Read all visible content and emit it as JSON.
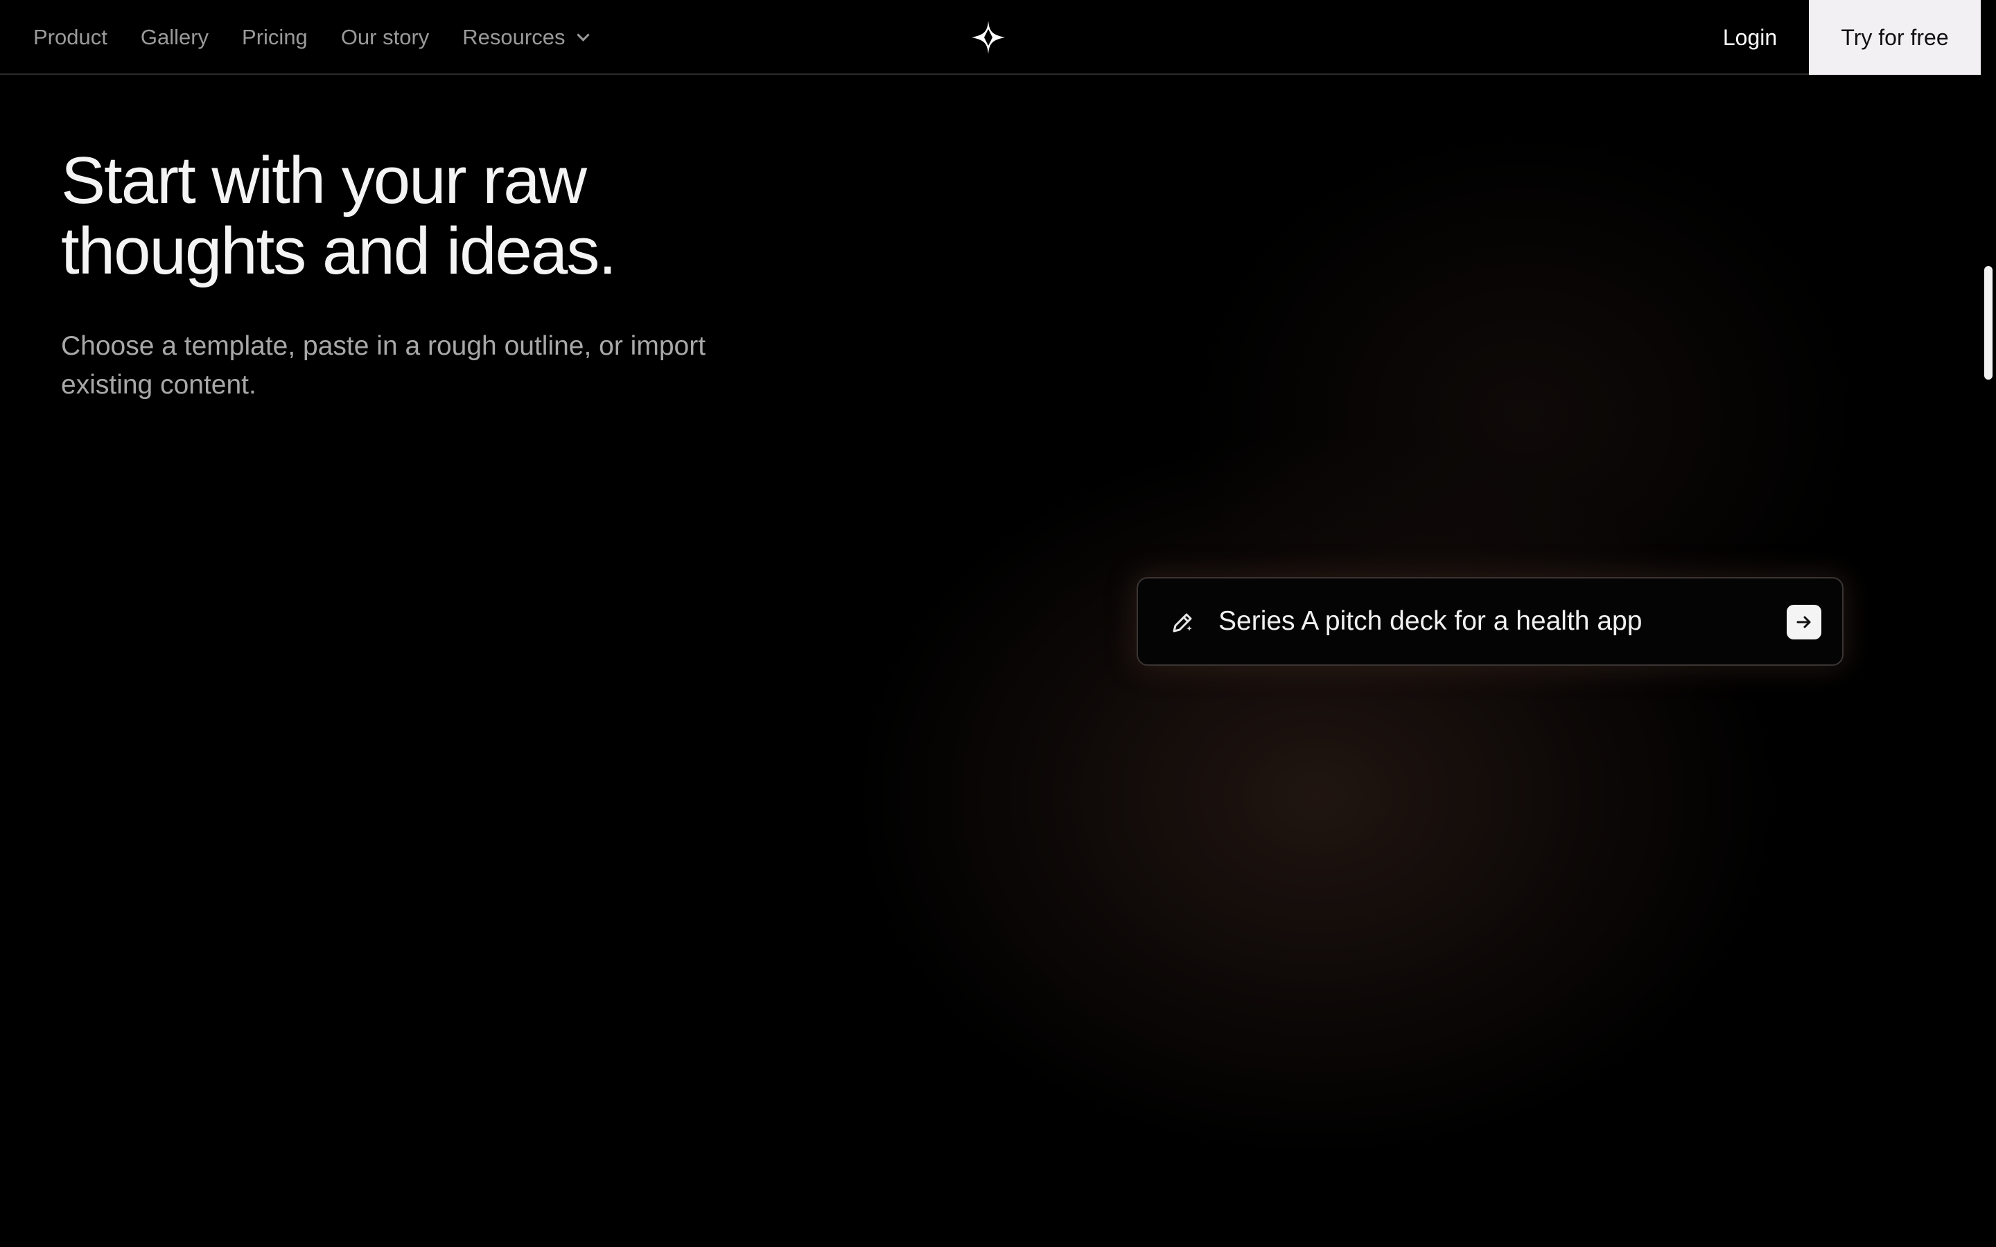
{
  "nav": {
    "items": [
      {
        "label": "Product"
      },
      {
        "label": "Gallery"
      },
      {
        "label": "Pricing"
      },
      {
        "label": "Our story"
      },
      {
        "label": "Resources"
      }
    ],
    "login_label": "Login",
    "cta_label": "Try for free"
  },
  "hero": {
    "headline_line1": "Start with your raw",
    "headline_line2": "thoughts and ideas.",
    "subhead_line1": "Choose a template, paste in a rough outline, or import",
    "subhead_line2": "existing content."
  },
  "prompt": {
    "text": "Series A pitch deck for a health app"
  },
  "icons": {
    "logo": "sparkle-icon",
    "prompt": "pencil-sparkle-icon",
    "submit": "arrow-right-icon",
    "dropdown": "chevron-down-icon"
  },
  "colors": {
    "background": "#000000",
    "cta_background": "#f2f0f3",
    "nav_text": "#9a9a9a",
    "headline": "#f4f4f4",
    "subhead": "#a8a8a8"
  }
}
